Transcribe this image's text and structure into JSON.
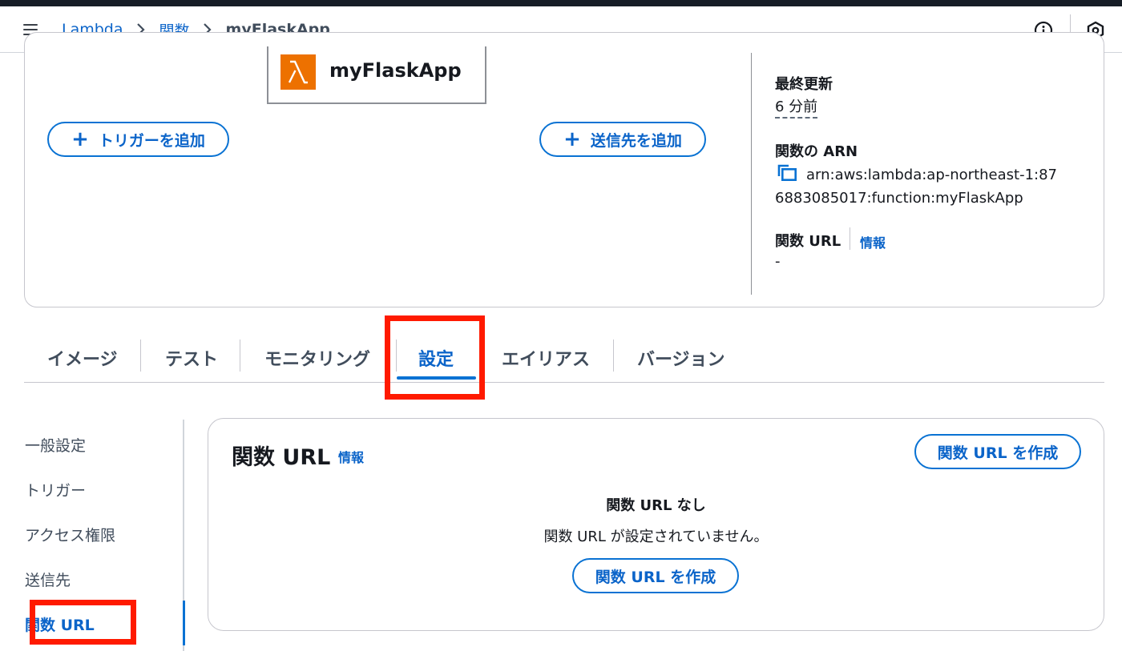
{
  "breadcrumb": {
    "items": [
      "Lambda",
      "関数"
    ],
    "current": "myFlaskApp"
  },
  "function_card": {
    "name": "myFlaskApp",
    "add_trigger_label": "トリガーを追加",
    "add_destination_label": "送信先を追加",
    "plus_symbol": "+",
    "last_modified_label": "最終更新",
    "last_modified_value": "6 分前",
    "arn_label": "関数の ARN",
    "arn_value": "arn:aws:lambda:ap-northeast-1:876883085017:function:myFlaskApp",
    "url_label": "関数 URL",
    "url_info": "情報",
    "url_value": "-"
  },
  "tabs": [
    "イメージ",
    "テスト",
    "モニタリング",
    "設定",
    "エイリアス",
    "バージョン"
  ],
  "active_tab": "設定",
  "side_nav": {
    "items": [
      "一般設定",
      "トリガー",
      "アクセス権限",
      "送信先",
      "関数 URL"
    ],
    "active": "関数 URL"
  },
  "url_panel": {
    "title": "関数 URL",
    "info": "情報",
    "create_button_label": "関数 URL を作成",
    "empty_title": "関数 URL なし",
    "empty_description": "関数 URL が設定されていません。"
  },
  "colors": {
    "link": "#0b64c9",
    "accent": "#0972d3",
    "lambda_orange": "#ed7100",
    "highlight_red": "#ff1a00",
    "top_bar": "#161d26"
  },
  "icons": [
    "menu-icon",
    "chevron-right-icon",
    "info-circle-icon",
    "hexagon-settings-icon",
    "lambda-icon",
    "plus-icon",
    "copy-icon"
  ]
}
